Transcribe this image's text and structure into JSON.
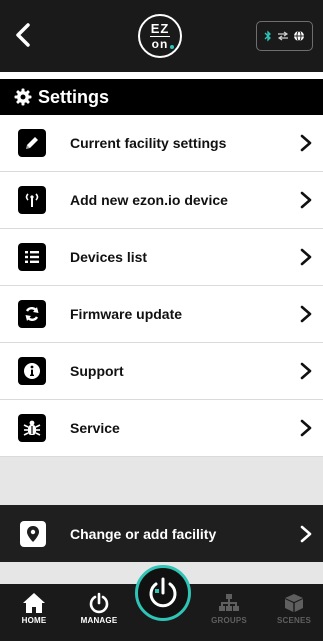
{
  "header": {
    "back_icon": "chevron-left-icon",
    "logo": {
      "top": "EZ",
      "bottom": "on"
    },
    "connection_icons": [
      "bluetooth-icon",
      "transfer-arrows-icon",
      "globe-icon"
    ],
    "colors": {
      "bluetooth": "#2ec4b6",
      "bar": "#1a1a1a"
    }
  },
  "section": {
    "icon": "gear-icon",
    "title": "Settings"
  },
  "menu": {
    "items": [
      {
        "id": "current-facility",
        "icon": "pencil-icon",
        "label": "Current facility settings"
      },
      {
        "id": "add-device",
        "icon": "antenna-icon",
        "label": "Add new ezon.io device"
      },
      {
        "id": "devices-list",
        "icon": "list-icon",
        "label": "Devices list"
      },
      {
        "id": "firmware-update",
        "icon": "refresh-icon",
        "label": "Firmware update"
      },
      {
        "id": "support",
        "icon": "info-icon",
        "label": "Support"
      },
      {
        "id": "service",
        "icon": "bug-icon",
        "label": "Service"
      }
    ]
  },
  "facility": {
    "icon": "location-pin-icon",
    "label": "Change or add facility"
  },
  "nav": {
    "items": [
      {
        "id": "home",
        "icon": "home-icon",
        "label": "HOME",
        "active": true
      },
      {
        "id": "manage",
        "icon": "power-icon",
        "label": "MANAGE",
        "active": true
      },
      {
        "id": "groups",
        "icon": "sitemap-icon",
        "label": "GROUPS",
        "active": false
      },
      {
        "id": "scenes",
        "icon": "cube-icon",
        "label": "SCENES",
        "active": false
      }
    ],
    "center_icon": "ezon-power-icon",
    "accent": "#2ec4b6"
  }
}
